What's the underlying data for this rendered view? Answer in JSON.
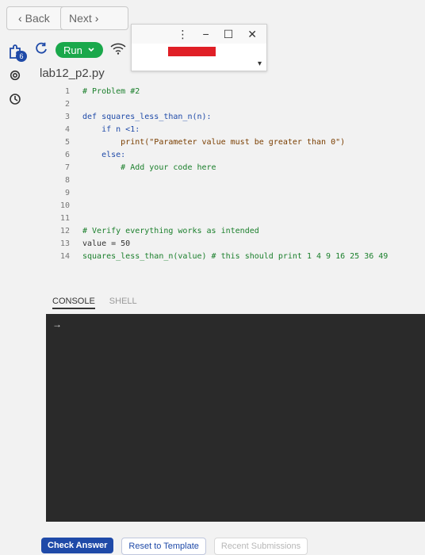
{
  "nav": {
    "back_label": "Back",
    "next_label": "Next"
  },
  "toolbar": {
    "run_label": "Run",
    "badge_count": "6"
  },
  "file": {
    "name": "lab12_p2.py"
  },
  "editor": {
    "lines": [
      {
        "n": "1",
        "text": "# Problem #2"
      },
      {
        "n": "2",
        "text": ""
      },
      {
        "n": "3",
        "text": "def squares_less_than_n(n):"
      },
      {
        "n": "4",
        "text": "    if n <1:"
      },
      {
        "n": "5",
        "text": "        print(\"Parameter value must be greater than 0\")"
      },
      {
        "n": "6",
        "text": "    else:"
      },
      {
        "n": "7",
        "text": "        # Add your code here"
      },
      {
        "n": "8",
        "text": ""
      },
      {
        "n": "9",
        "text": ""
      },
      {
        "n": "10",
        "text": ""
      },
      {
        "n": "11",
        "text": ""
      },
      {
        "n": "12",
        "text": "# Verify everything works as intended"
      },
      {
        "n": "13",
        "text": "value = 50"
      },
      {
        "n": "14",
        "text": "squares_less_than_n(value) # this should print 1 4 9 16 25 36 49"
      }
    ]
  },
  "tabs": {
    "console": "CONSOLE",
    "shell": "SHELL"
  },
  "console": {
    "prompt_arrow": "→"
  },
  "footer": {
    "check": "Check Answer",
    "reset": "Reset to Template",
    "recent": "Recent Submissions"
  },
  "icons": {
    "chevron_left": "‹",
    "chevron_right": "›"
  },
  "colors": {
    "run_green": "#1aa84b",
    "link_blue": "#1f4aa8",
    "red_bar": "#e01f26"
  }
}
